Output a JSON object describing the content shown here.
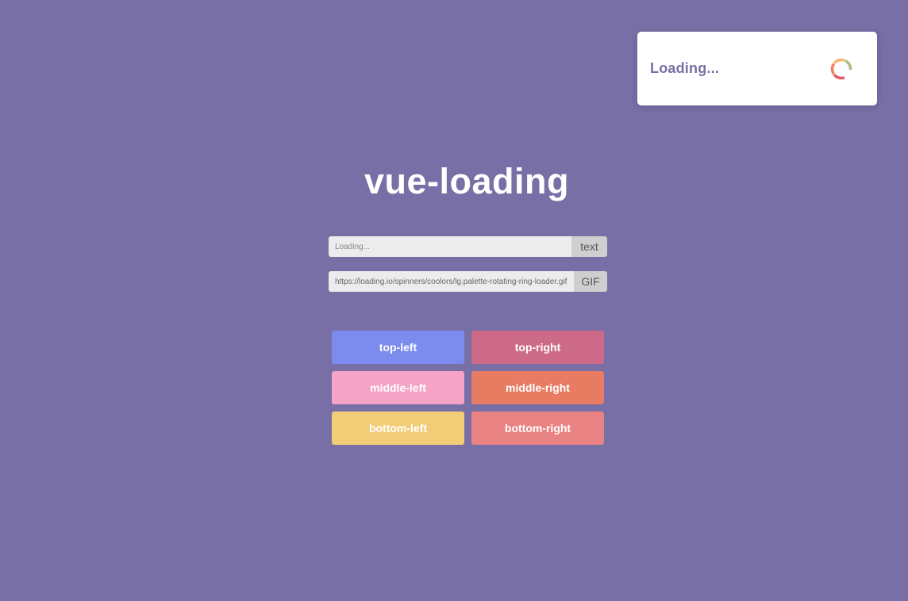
{
  "toast": {
    "message": "Loading...",
    "spinner_icon": "spinner-ring-icon",
    "spinner_colors": [
      "#e15b64",
      "#f47e60",
      "#f8b26a",
      "#abbd81"
    ]
  },
  "page": {
    "title": "vue-loading",
    "background_color": "#776fa5"
  },
  "text_input": {
    "value": "",
    "placeholder": "Loading...",
    "addon_label": "text"
  },
  "gif_input": {
    "value": "https://loading.io/spinners/coolors/lg.palette-rotating-ring-loader.gif",
    "placeholder": "",
    "addon_label": "GIF"
  },
  "buttons": [
    {
      "label": "top-left",
      "color": "#7b8cee"
    },
    {
      "label": "top-right",
      "color": "#cd6a87"
    },
    {
      "label": "middle-left",
      "color": "#f5a3c6"
    },
    {
      "label": "middle-right",
      "color": "#e87c62"
    },
    {
      "label": "bottom-left",
      "color": "#f2cd78"
    },
    {
      "label": "bottom-right",
      "color": "#e98282"
    }
  ]
}
